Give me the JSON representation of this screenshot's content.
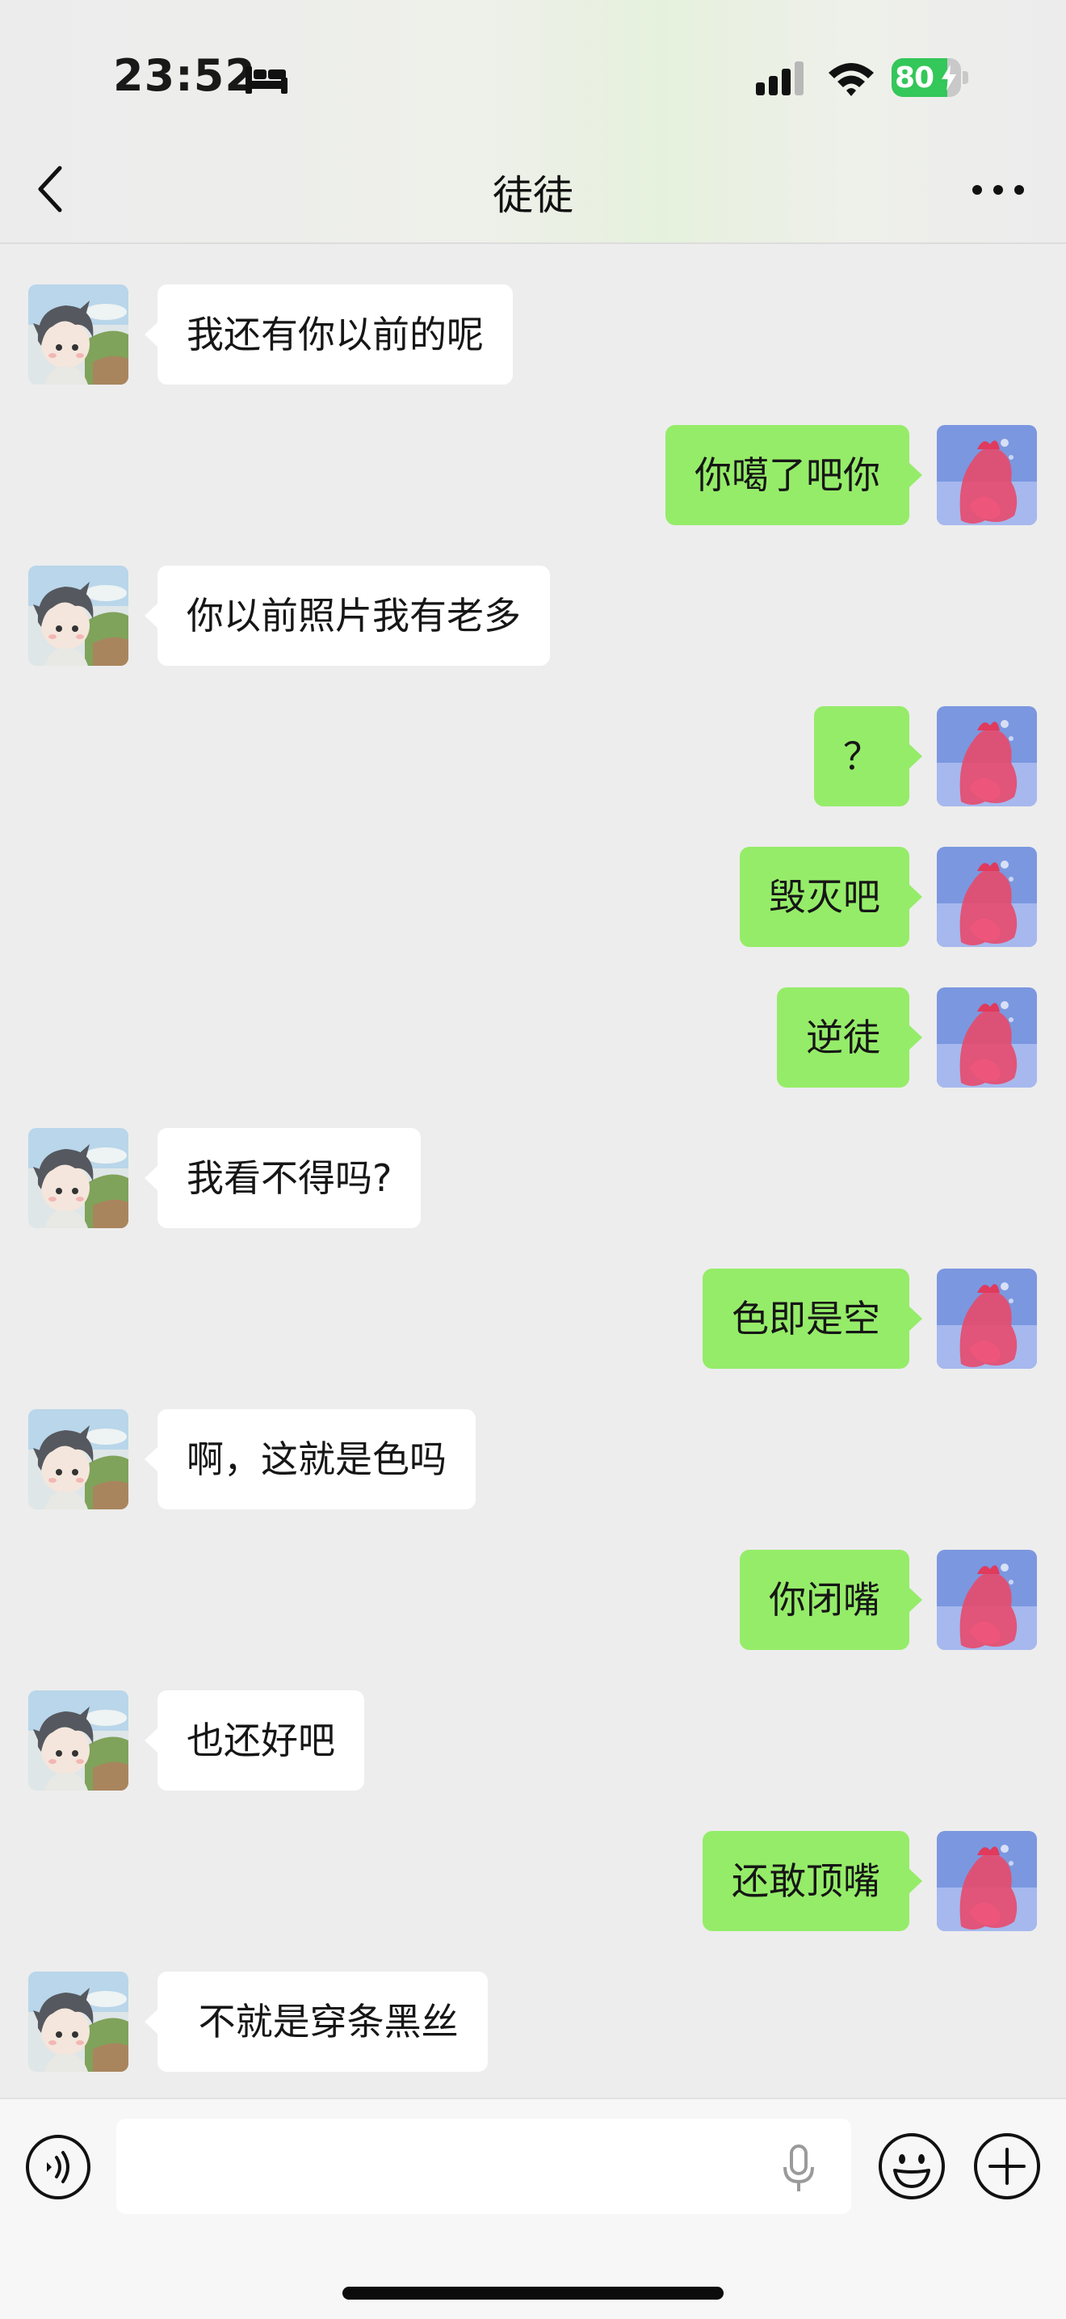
{
  "status_bar": {
    "time": "23:52",
    "battery_level": "80",
    "battery_fraction": 0.8,
    "icons": [
      "sleep-focus-icon",
      "cellular-signal-icon",
      "wifi-icon",
      "battery-charging-icon"
    ]
  },
  "nav": {
    "title": "徒徒",
    "back_icon": "chevron-left-icon",
    "more_icon": "more-dots-icon"
  },
  "colors": {
    "outgoing_bubble": "#95ec69",
    "incoming_bubble": "#ffffff",
    "background": "#ededed"
  },
  "messages": [
    {
      "side": "in",
      "text": "我还有你以前的呢"
    },
    {
      "side": "out",
      "text": "你噶了吧你"
    },
    {
      "side": "in",
      "text": "你以前照片我有老多"
    },
    {
      "side": "out",
      "text": "？"
    },
    {
      "side": "out",
      "text": "毁灭吧"
    },
    {
      "side": "out",
      "text": "逆徒"
    },
    {
      "side": "in",
      "text": "我看不得吗?"
    },
    {
      "side": "out",
      "text": "色即是空"
    },
    {
      "side": "in",
      "text": "啊，这就是色吗"
    },
    {
      "side": "out",
      "text": "你闭嘴"
    },
    {
      "side": "in",
      "text": "也还好吧"
    },
    {
      "side": "out",
      "text": "还敢顶嘴"
    },
    {
      "side": "in",
      "text": " 不就是穿条黑丝"
    }
  ],
  "input_bar": {
    "text_value": "",
    "icons": [
      "voice-mode-icon",
      "microphone-icon",
      "emoji-icon",
      "plus-icon"
    ]
  }
}
